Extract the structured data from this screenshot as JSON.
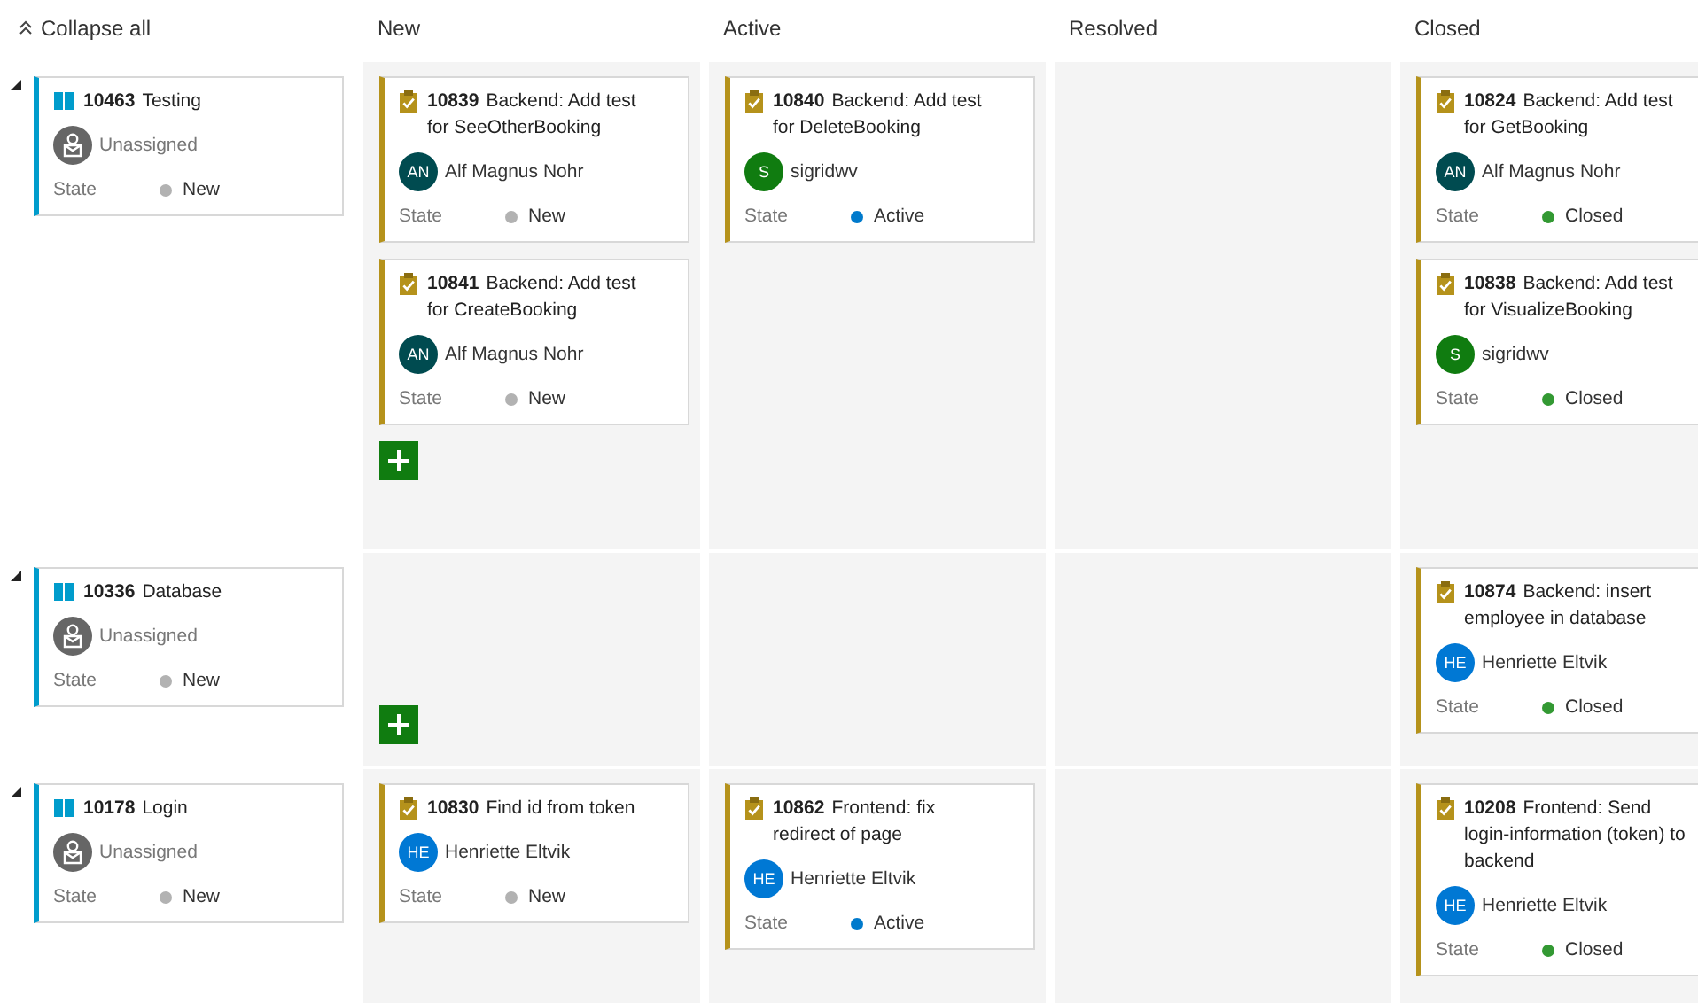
{
  "collapse_label": "Collapse all",
  "columns": [
    {
      "title": "New"
    },
    {
      "title": "Active"
    },
    {
      "title": "Resolved"
    },
    {
      "title": "Closed"
    }
  ],
  "rows": [
    {
      "expanded": true,
      "parent": {
        "id": "10463",
        "title": "Testing",
        "assignee": {
          "kind": "unassigned",
          "name": "Unassigned"
        },
        "state": {
          "label": "State",
          "value": "New",
          "color": "#b2b2b2"
        }
      },
      "cells": [
        {
          "add": true,
          "cards": [
            {
              "id": "10839",
              "title": "Backend: Add test for SeeOtherBooking",
              "assignee": {
                "kind": "person",
                "initials": "AN",
                "name": "Alf Magnus Nohr",
                "color": "#004b50"
              },
              "state": {
                "label": "State",
                "value": "New",
                "color": "#b2b2b2"
              }
            },
            {
              "id": "10841",
              "title": "Backend: Add test for CreateBooking",
              "assignee": {
                "kind": "person",
                "initials": "AN",
                "name": "Alf Magnus Nohr",
                "color": "#004b50"
              },
              "state": {
                "label": "State",
                "value": "New",
                "color": "#b2b2b2"
              }
            }
          ]
        },
        {
          "add": false,
          "cards": [
            {
              "id": "10840",
              "title": "Backend: Add test for DeleteBooking",
              "assignee": {
                "kind": "person",
                "initials": "S",
                "name": "sigridwv",
                "color": "#107c10"
              },
              "state": {
                "label": "State",
                "value": "Active",
                "color": "#007acc"
              }
            }
          ]
        },
        {
          "add": false
        },
        {
          "add": false,
          "cards": [
            {
              "id": "10824",
              "title": "Backend: Add test for GetBooking",
              "assignee": {
                "kind": "person",
                "initials": "AN",
                "name": "Alf Magnus Nohr",
                "color": "#004b50"
              },
              "state": {
                "label": "State",
                "value": "Closed",
                "color": "#339933"
              }
            },
            {
              "id": "10838",
              "title": "Backend: Add test for VisualizeBooking",
              "assignee": {
                "kind": "person",
                "initials": "S",
                "name": "sigridwv",
                "color": "#107c10"
              },
              "state": {
                "label": "State",
                "value": "Closed",
                "color": "#339933"
              }
            }
          ]
        }
      ]
    },
    {
      "expanded": true,
      "parent": {
        "id": "10336",
        "title": "Database",
        "assignee": {
          "kind": "unassigned",
          "name": "Unassigned"
        },
        "state": {
          "label": "State",
          "value": "New",
          "color": "#b2b2b2"
        }
      },
      "cells": [
        {
          "add": true
        },
        {
          "add": false
        },
        {
          "add": false
        },
        {
          "add": false,
          "cards": [
            {
              "id": "10874",
              "title": "Backend: insert employee in database",
              "assignee": {
                "kind": "person",
                "initials": "HE",
                "name": "Henriette Eltvik",
                "color": "#0078d4"
              },
              "state": {
                "label": "State",
                "value": "Closed",
                "color": "#339933"
              }
            }
          ]
        }
      ]
    },
    {
      "expanded": true,
      "parent": {
        "id": "10178",
        "title": "Login",
        "assignee": {
          "kind": "unassigned",
          "name": "Unassigned"
        },
        "state": {
          "label": "State",
          "value": "New",
          "color": "#b2b2b2"
        }
      },
      "cells": [
        {
          "add": false,
          "cards": [
            {
              "id": "10830",
              "title": "Find id from token",
              "assignee": {
                "kind": "person",
                "initials": "HE",
                "name": "Henriette Eltvik",
                "color": "#0078d4"
              },
              "state": {
                "label": "State",
                "value": "New",
                "color": "#b2b2b2"
              }
            }
          ]
        },
        {
          "add": false,
          "cards": [
            {
              "id": "10862",
              "title": "Frontend: fix redirect of page",
              "assignee": {
                "kind": "person",
                "initials": "HE",
                "name": "Henriette Eltvik",
                "color": "#0078d4"
              },
              "state": {
                "label": "State",
                "value": "Active",
                "color": "#007acc"
              }
            }
          ]
        },
        {
          "add": false
        },
        {
          "add": false,
          "cards": [
            {
              "id": "10208",
              "title": "Frontend: Send login-information (token) to backend",
              "assignee": {
                "kind": "person",
                "initials": "HE",
                "name": "Henriette Eltvik",
                "color": "#0078d4"
              },
              "state": {
                "label": "State",
                "value": "Closed",
                "color": "#339933"
              }
            }
          ]
        }
      ]
    }
  ]
}
